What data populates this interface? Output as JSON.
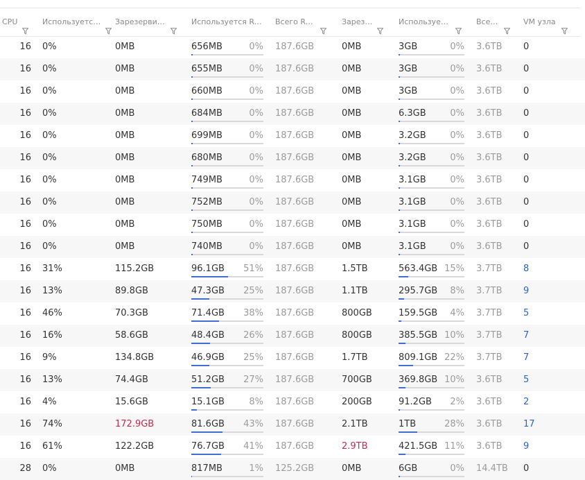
{
  "columns": [
    {
      "key": "cpu",
      "label": "CPU"
    },
    {
      "key": "cpu_used",
      "label": "Используется CPU"
    },
    {
      "key": "reserved",
      "label": "Зарезервировано RAM"
    },
    {
      "key": "ram_used",
      "label": "Используется RAM"
    },
    {
      "key": "ram_total",
      "label": "Всего RAM"
    },
    {
      "key": "disk_reserved",
      "label": "Зарезервировано диска"
    },
    {
      "key": "disk_used",
      "label": "Используется диска"
    },
    {
      "key": "disk_total",
      "label": "Всего диска"
    },
    {
      "key": "vm",
      "label": "VM узла"
    }
  ],
  "colors": {
    "link": "#2b64c8",
    "alert": "#c8284c",
    "bar_fill": "#3f6fd6",
    "bar_track": "#d9d9d9"
  },
  "rows": [
    {
      "cpu": "16",
      "cpu_used": "0%",
      "reserved": "0MB",
      "ram_used": "656MB",
      "ram_pct": "0%",
      "ram_total": "187.6GB",
      "disk_reserved": "0MB",
      "disk_used": "3GB",
      "disk_pct": "0%",
      "disk_total": "3.6TB",
      "vm": "0"
    },
    {
      "cpu": "16",
      "cpu_used": "0%",
      "reserved": "0MB",
      "ram_used": "655MB",
      "ram_pct": "0%",
      "ram_total": "187.6GB",
      "disk_reserved": "0MB",
      "disk_used": "3GB",
      "disk_pct": "0%",
      "disk_total": "3.6TB",
      "vm": "0"
    },
    {
      "cpu": "16",
      "cpu_used": "0%",
      "reserved": "0MB",
      "ram_used": "660MB",
      "ram_pct": "0%",
      "ram_total": "187.6GB",
      "disk_reserved": "0MB",
      "disk_used": "3GB",
      "disk_pct": "0%",
      "disk_total": "3.6TB",
      "vm": "0"
    },
    {
      "cpu": "16",
      "cpu_used": "0%",
      "reserved": "0MB",
      "ram_used": "684MB",
      "ram_pct": "0%",
      "ram_total": "187.6GB",
      "disk_reserved": "0MB",
      "disk_used": "6.3GB",
      "disk_pct": "0%",
      "disk_total": "3.6TB",
      "vm": "0"
    },
    {
      "cpu": "16",
      "cpu_used": "0%",
      "reserved": "0MB",
      "ram_used": "699MB",
      "ram_pct": "0%",
      "ram_total": "187.6GB",
      "disk_reserved": "0MB",
      "disk_used": "3.2GB",
      "disk_pct": "0%",
      "disk_total": "3.6TB",
      "vm": "0"
    },
    {
      "cpu": "16",
      "cpu_used": "0%",
      "reserved": "0MB",
      "ram_used": "680MB",
      "ram_pct": "0%",
      "ram_total": "187.6GB",
      "disk_reserved": "0MB",
      "disk_used": "3.2GB",
      "disk_pct": "0%",
      "disk_total": "3.6TB",
      "vm": "0"
    },
    {
      "cpu": "16",
      "cpu_used": "0%",
      "reserved": "0MB",
      "ram_used": "749MB",
      "ram_pct": "0%",
      "ram_total": "187.6GB",
      "disk_reserved": "0MB",
      "disk_used": "3.1GB",
      "disk_pct": "0%",
      "disk_total": "3.6TB",
      "vm": "0"
    },
    {
      "cpu": "16",
      "cpu_used": "0%",
      "reserved": "0MB",
      "ram_used": "752MB",
      "ram_pct": "0%",
      "ram_total": "187.6GB",
      "disk_reserved": "0MB",
      "disk_used": "3.1GB",
      "disk_pct": "0%",
      "disk_total": "3.6TB",
      "vm": "0"
    },
    {
      "cpu": "16",
      "cpu_used": "0%",
      "reserved": "0MB",
      "ram_used": "750MB",
      "ram_pct": "0%",
      "ram_total": "187.6GB",
      "disk_reserved": "0MB",
      "disk_used": "3.1GB",
      "disk_pct": "0%",
      "disk_total": "3.6TB",
      "vm": "0"
    },
    {
      "cpu": "16",
      "cpu_used": "0%",
      "reserved": "0MB",
      "ram_used": "740MB",
      "ram_pct": "0%",
      "ram_total": "187.6GB",
      "disk_reserved": "0MB",
      "disk_used": "3.1GB",
      "disk_pct": "0%",
      "disk_total": "3.6TB",
      "vm": "0"
    },
    {
      "cpu": "16",
      "cpu_used": "31%",
      "reserved": "115.2GB",
      "ram_used": "96.1GB",
      "ram_pct": "51%",
      "ram_total": "187.6GB",
      "disk_reserved": "1.5TB",
      "disk_used": "563.4GB",
      "disk_pct": "15%",
      "disk_total": "3.7TB",
      "vm": "8",
      "vm_link": true
    },
    {
      "cpu": "16",
      "cpu_used": "13%",
      "reserved": "89.8GB",
      "ram_used": "47.3GB",
      "ram_pct": "25%",
      "ram_total": "187.6GB",
      "disk_reserved": "1.1TB",
      "disk_used": "295.7GB",
      "disk_pct": "8%",
      "disk_total": "3.7TB",
      "vm": "9",
      "vm_link": true
    },
    {
      "cpu": "16",
      "cpu_used": "46%",
      "reserved": "70.3GB",
      "ram_used": "71.4GB",
      "ram_pct": "38%",
      "ram_total": "187.6GB",
      "disk_reserved": "800GB",
      "disk_used": "159.5GB",
      "disk_pct": "4%",
      "disk_total": "3.7TB",
      "vm": "5",
      "vm_link": true
    },
    {
      "cpu": "16",
      "cpu_used": "16%",
      "reserved": "58.6GB",
      "ram_used": "48.4GB",
      "ram_pct": "26%",
      "ram_total": "187.6GB",
      "disk_reserved": "800GB",
      "disk_used": "385.5GB",
      "disk_pct": "10%",
      "disk_total": "3.7TB",
      "vm": "7",
      "vm_link": true
    },
    {
      "cpu": "16",
      "cpu_used": "9%",
      "reserved": "134.8GB",
      "ram_used": "46.9GB",
      "ram_pct": "25%",
      "ram_total": "187.6GB",
      "disk_reserved": "1.7TB",
      "disk_used": "809.1GB",
      "disk_pct": "22%",
      "disk_total": "3.7TB",
      "vm": "7",
      "vm_link": true
    },
    {
      "cpu": "16",
      "cpu_used": "13%",
      "reserved": "74.4GB",
      "ram_used": "51.2GB",
      "ram_pct": "27%",
      "ram_total": "187.6GB",
      "disk_reserved": "700GB",
      "disk_used": "369.8GB",
      "disk_pct": "10%",
      "disk_total": "3.6TB",
      "vm": "5",
      "vm_link": true
    },
    {
      "cpu": "16",
      "cpu_used": "4%",
      "reserved": "15.6GB",
      "ram_used": "15.1GB",
      "ram_pct": "8%",
      "ram_total": "187.6GB",
      "disk_reserved": "200GB",
      "disk_used": "91.2GB",
      "disk_pct": "2%",
      "disk_total": "3.6TB",
      "vm": "2",
      "vm_link": true
    },
    {
      "cpu": "16",
      "cpu_used": "74%",
      "reserved": "172.9GB",
      "reserved_alert": true,
      "ram_used": "81.6GB",
      "ram_pct": "43%",
      "ram_total": "187.6GB",
      "disk_reserved": "2.1TB",
      "disk_used": "1TB",
      "disk_pct": "28%",
      "disk_total": "3.6TB",
      "vm": "17",
      "vm_link": true
    },
    {
      "cpu": "16",
      "cpu_used": "61%",
      "reserved": "122.2GB",
      "ram_used": "76.7GB",
      "ram_pct": "41%",
      "ram_total": "187.6GB",
      "disk_reserved": "2.9TB",
      "disk_reserved_alert": true,
      "disk_used": "421.5GB",
      "disk_pct": "11%",
      "disk_total": "3.6TB",
      "vm": "9",
      "vm_link": true
    },
    {
      "cpu": "28",
      "cpu_used": "0%",
      "reserved": "0MB",
      "ram_used": "817MB",
      "ram_pct": "1%",
      "ram_total": "125.2GB",
      "disk_reserved": "0MB",
      "disk_used": "6GB",
      "disk_pct": "0%",
      "disk_total": "14.4TB",
      "vm": "0"
    }
  ]
}
